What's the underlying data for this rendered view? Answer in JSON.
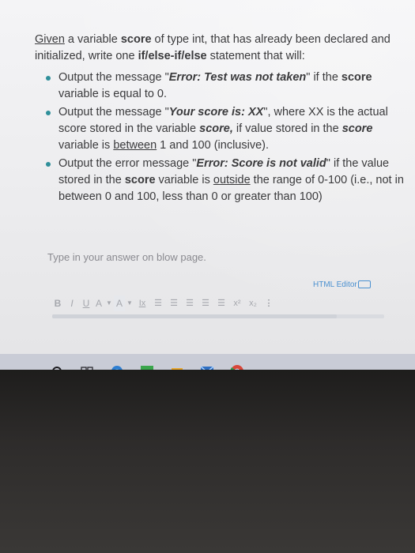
{
  "question": {
    "intro": {
      "given": "Given",
      "p1": " a variable ",
      "score": "score",
      "p2": " of type int, that has already been declared and initialized, write one ",
      "ifelse": "if/else-if/else",
      "p3": " statement that will:"
    },
    "bullet1": {
      "p1": "Output the message \"",
      "msg": "Error: Test was not taken",
      "p2": "\" if the ",
      "score": "score",
      "p3": " variable is equal to 0."
    },
    "bullet2": {
      "p1": "Output the message \"",
      "msg": "Your score is: XX",
      "p2": "\", where XX is the actual score stored in the variable ",
      "score": "score,",
      "p3": " if value stored in the ",
      "score2": "score",
      "p4": " variable is ",
      "between": "between",
      "p5": " 1 and 100 (inclusive)."
    },
    "bullet3": {
      "p1": "Output the error message \"",
      "msg": "Error: Score is not valid",
      "p2": "\" if the value stored in the ",
      "score": "score",
      "p3": " variable is ",
      "outside": "outside",
      "p4": " the range of 0-100 (i.e., not in between 0 and 100, less than 0 or greater than 100)"
    }
  },
  "answer_hint": "Type in your answer on blow page.",
  "editor": {
    "label": "HTML Editor",
    "toolbar": {
      "bold": "B",
      "italic": "I",
      "underline": "U",
      "font_color": "A",
      "highlight": "A",
      "clear_format": "Ix",
      "superscript": "x²",
      "subscript": "x₂",
      "more": "⋮"
    }
  },
  "taskbar_icons": [
    "circle-icon",
    "task-view-icon",
    "edge-icon",
    "photos-icon",
    "store-icon",
    "mail-icon",
    "chrome-icon"
  ],
  "colors": {
    "bullet": "#2f8f9a",
    "editor_label": "#4a90d0",
    "text": "#3a3a3c"
  }
}
